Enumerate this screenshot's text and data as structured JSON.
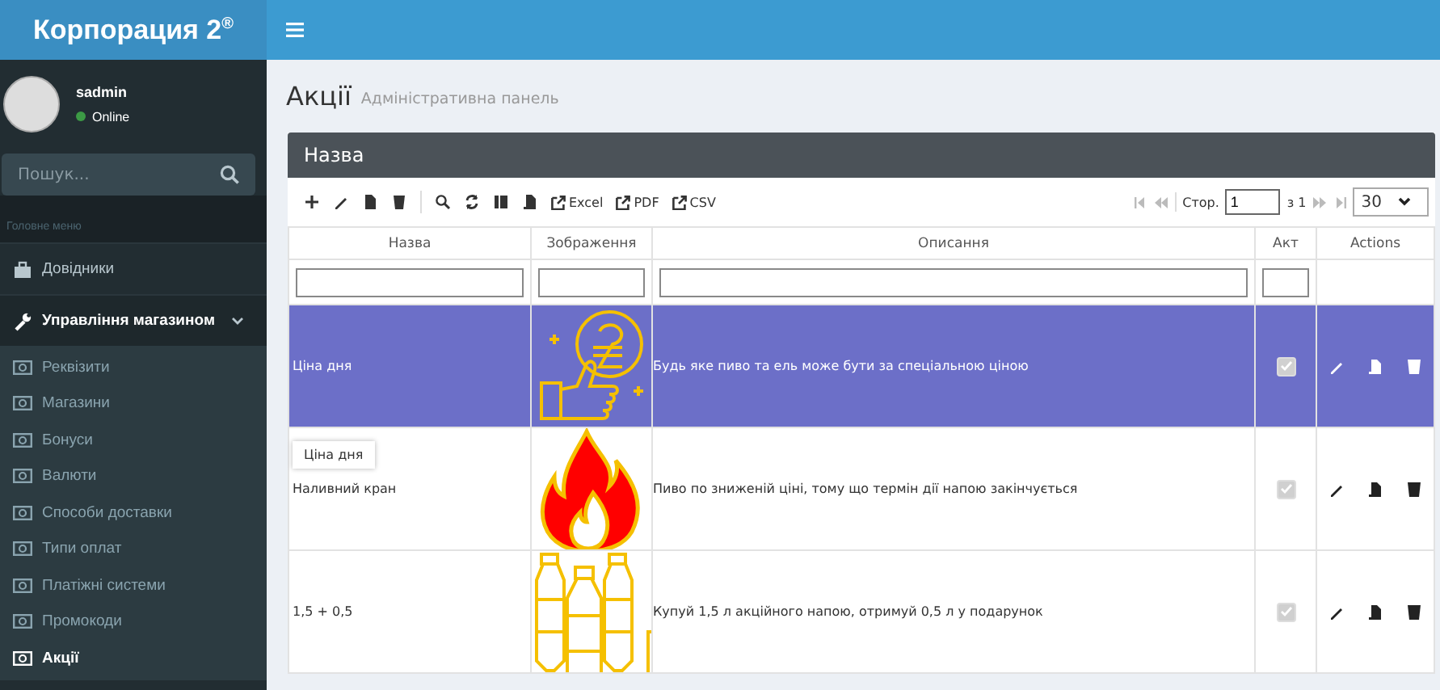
{
  "logo": "Корпорация 2$^{®}$",
  "user": {
    "name": "sadmin",
    "status": "Online"
  },
  "sidebar": {
    "search": {
      "placeholder": "Пошук..."
    },
    "menu_header": "Головне меню",
    "items": [
      {
        "label": "Довідники",
        "kind": "briefcase",
        "expanded": false
      },
      {
        "label": "Управління магазином",
        "kind": "wrench",
        "expanded": true,
        "children": [
          {
            "label": "Реквізити",
            "selected": false
          },
          {
            "label": "Магазини",
            "selected": false
          },
          {
            "label": "Бонуси",
            "selected": false
          },
          {
            "label": "Валюти",
            "selected": false
          },
          {
            "label": "Способи доставки",
            "selected": false
          },
          {
            "label": "Типи оплат",
            "selected": false
          },
          {
            "label": "Платіжні системи",
            "selected": false
          },
          {
            "label": "Промокоди",
            "selected": false
          },
          {
            "label": "Акції",
            "selected": true
          }
        ]
      }
    ]
  },
  "page": {
    "title": "Акції",
    "subtitle": "Адміністративна панель"
  },
  "grid": {
    "caption": "Назва",
    "exports": [
      "Excel",
      "PDF",
      "CSV"
    ],
    "pager": {
      "page_label": "Стор.",
      "page": "1",
      "of": "з 1",
      "page_size": "30"
    },
    "columns": [
      "Назва",
      "Зображення",
      "Описання",
      "Акт",
      "Actions"
    ],
    "rows": [
      {
        "name": "Ціна дня",
        "kind": "coin",
        "description": "Будь яке пиво та ель може бути за спеціальною ціною",
        "active": true,
        "selected": true
      },
      {
        "name": "Наливний кран",
        "kind": "fire",
        "description": "Пиво по зниженій ціні, тому що термін дії напою закінчується",
        "active": true,
        "selected": false
      },
      {
        "name": "1,5 + 0,5",
        "kind": "bottles",
        "description": "Купуй 1,5 л акційного напою, отримуй 0,5 л у подарунок",
        "active": true,
        "selected": false
      }
    ]
  },
  "tooltip": "Ціна дня"
}
